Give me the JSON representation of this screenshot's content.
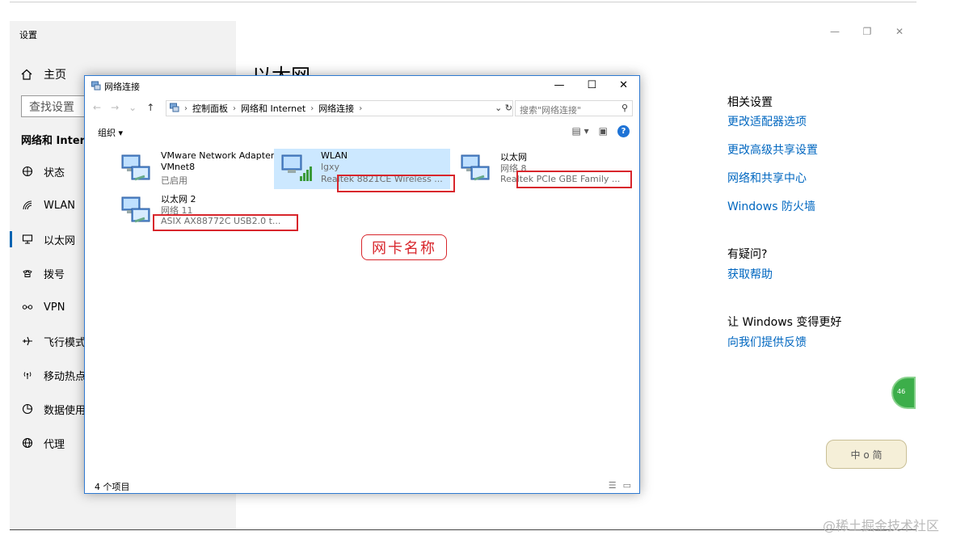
{
  "settings": {
    "app_title": "设置",
    "home_label": "主页",
    "search_placeholder": "查找设置",
    "section_title": "网络和 Intern",
    "nav": [
      {
        "label": "状态",
        "icon": "globe-icon"
      },
      {
        "label": "WLAN",
        "icon": "wifi-icon"
      },
      {
        "label": "以太网",
        "icon": "ethernet-icon",
        "active": true
      },
      {
        "label": "拨号",
        "icon": "phone-icon"
      },
      {
        "label": "VPN",
        "icon": "vpn-icon"
      },
      {
        "label": "飞行模式",
        "icon": "airplane-icon"
      },
      {
        "label": "移动热点",
        "icon": "hotspot-icon"
      },
      {
        "label": "数据使用",
        "icon": "data-usage-icon"
      },
      {
        "label": "代理",
        "icon": "globe-icon"
      }
    ],
    "page_heading": "以太网",
    "related": {
      "heading": "相关设置",
      "links": [
        "更改适配器选项",
        "更改高级共享设置",
        "网络和共享中心",
        "Windows 防火墙"
      ]
    },
    "question": {
      "heading": "有疑问?",
      "link": "获取帮助"
    },
    "improve": {
      "heading": "让 Windows 变得更好",
      "link": "向我们提供反馈"
    }
  },
  "explorer": {
    "title": "网络连接",
    "breadcrumb": [
      "控制面板",
      "网络和 Internet",
      "网络连接"
    ],
    "search_placeholder": "搜索\"网络连接\"",
    "organize_label": "组织 ▾",
    "items": [
      {
        "name": "VMware Network Adapter VMnet8",
        "status": "已启用",
        "adapter": ""
      },
      {
        "name": "WLAN",
        "status": "lgxy",
        "adapter": "Realtek 8821CE Wireless ..."
      },
      {
        "name": "以太网",
        "status": "网络 8",
        "adapter": "Realtek PCIe GBE Family ..."
      },
      {
        "name": "以太网 2",
        "status": "网络 11",
        "adapter": "ASIX AX88772C USB2.0 t..."
      }
    ],
    "annotation": "网卡名称",
    "status_bar": "4 个项目"
  },
  "overlay": {
    "bubble_text": "46",
    "logo_text": "中 o 简",
    "watermark": "@稀土掘金技术社区"
  },
  "colors": {
    "accent": "#0067c0",
    "annotation_red": "#d8262c",
    "selection": "#cce8ff"
  }
}
